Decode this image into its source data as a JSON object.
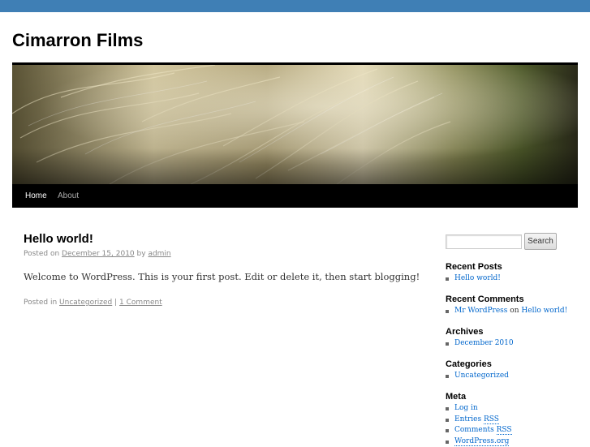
{
  "site": {
    "title": "Cimarron Films"
  },
  "nav": {
    "items": [
      {
        "label": "Home"
      },
      {
        "label": "About"
      }
    ]
  },
  "post": {
    "title": "Hello world!",
    "posted_on_prefix": "Posted on",
    "date": "December 15, 2010",
    "by_text": "by",
    "author": "admin",
    "body": "Welcome to WordPress. This is your first post. Edit or delete it, then start blogging!",
    "posted_in_prefix": "Posted in",
    "category": "Uncategorized",
    "separator": "|",
    "comments": "1 Comment"
  },
  "sidebar": {
    "search": {
      "placeholder": "",
      "button_label": "Search"
    },
    "recent_posts": {
      "title": "Recent Posts",
      "items": [
        "Hello world!"
      ]
    },
    "recent_comments": {
      "title": "Recent Comments",
      "author": "Mr WordPress",
      "on_text": "on",
      "post": "Hello world!"
    },
    "archives": {
      "title": "Archives",
      "items": [
        "December 2010"
      ]
    },
    "categories": {
      "title": "Categories",
      "items": [
        "Uncategorized"
      ]
    },
    "meta": {
      "title": "Meta",
      "items": [
        "Log in",
        "Entries",
        "RSS",
        "Comments",
        "RSS",
        "WordPress.org"
      ]
    }
  },
  "colors": {
    "top_bar": "#3f7fb5",
    "link": "#0066cc",
    "nav_bg": "#000000"
  },
  "icons": {
    "list_bullet": "square-bullet-icon"
  }
}
